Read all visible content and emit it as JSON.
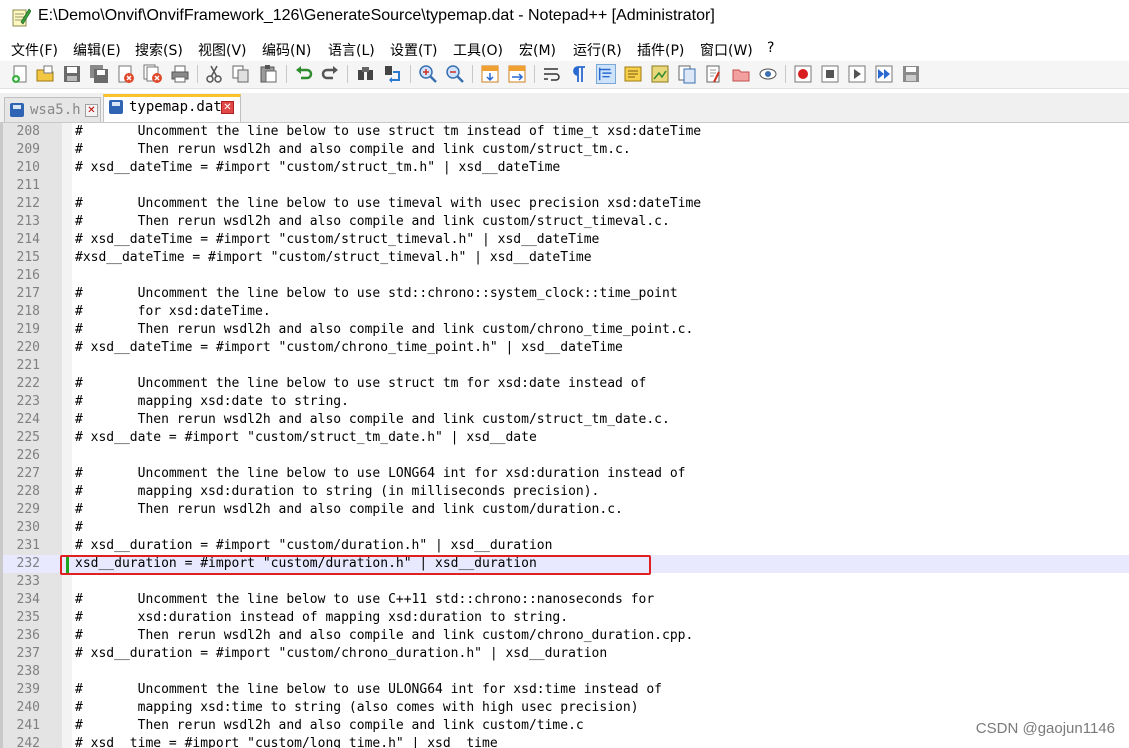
{
  "window": {
    "title": "E:\\Demo\\Onvif\\OnvifFramework_126\\GenerateSource\\typemap.dat - Notepad++ [Administrator]",
    "app_icon": "notepad-icon"
  },
  "menu": [
    "文件(F)",
    "编辑(E)",
    "搜索(S)",
    "视图(V)",
    "编码(N)",
    "语言(L)",
    "设置(T)",
    "工具(O)",
    "宏(M)",
    "运行(R)",
    "插件(P)",
    "窗口(W)",
    "?"
  ],
  "toolbar": [
    "new-file-icon",
    "open-file-icon",
    "save-icon",
    "save-all-icon",
    "close-icon",
    "close-all-icon",
    "print-icon",
    "cut-icon",
    "copy-icon",
    "paste-icon",
    "undo-icon",
    "redo-icon",
    "find-icon",
    "replace-icon",
    "zoom-in-icon",
    "zoom-out-icon",
    "sync-vertical-icon",
    "sync-horizontal-icon",
    "word-wrap-icon",
    "show-all-chars-icon",
    "indent-guide-icon",
    "udl-icon",
    "doc-map-icon",
    "function-list-icon",
    "folder-workspace-icon",
    "doc-list-icon",
    "monitor-icon",
    "record-macro-icon",
    "stop-macro-icon",
    "play-macro-icon",
    "run-macro-multiple-icon",
    "save-macro-icon"
  ],
  "tabs": [
    {
      "label": "wsa5.h",
      "active": false
    },
    {
      "label": "typemap.dat",
      "active": true
    }
  ],
  "editor": {
    "current_line": 232,
    "lines": [
      {
        "n": "208",
        "text": "#       Uncomment the line below to use struct tm instead of time_t xsd:dateTime"
      },
      {
        "n": "209",
        "text": "#       Then rerun wsdl2h and also compile and link custom/struct_tm.c."
      },
      {
        "n": "210",
        "text": "# xsd__dateTime = #import \"custom/struct_tm.h\" | xsd__dateTime"
      },
      {
        "n": "211",
        "text": ""
      },
      {
        "n": "212",
        "text": "#       Uncomment the line below to use timeval with usec precision xsd:dateTime"
      },
      {
        "n": "213",
        "text": "#       Then rerun wsdl2h and also compile and link custom/struct_timeval.c."
      },
      {
        "n": "214",
        "text": "# xsd__dateTime = #import \"custom/struct_timeval.h\" | xsd__dateTime"
      },
      {
        "n": "215",
        "text": "#xsd__dateTime = #import \"custom/struct_timeval.h\" | xsd__dateTime"
      },
      {
        "n": "216",
        "text": ""
      },
      {
        "n": "217",
        "text": "#       Uncomment the line below to use std::chrono::system_clock::time_point"
      },
      {
        "n": "218",
        "text": "#       for xsd:dateTime."
      },
      {
        "n": "219",
        "text": "#       Then rerun wsdl2h and also compile and link custom/chrono_time_point.c."
      },
      {
        "n": "220",
        "text": "# xsd__dateTime = #import \"custom/chrono_time_point.h\" | xsd__dateTime"
      },
      {
        "n": "221",
        "text": ""
      },
      {
        "n": "222",
        "text": "#       Uncomment the line below to use struct tm for xsd:date instead of"
      },
      {
        "n": "223",
        "text": "#       mapping xsd:date to string."
      },
      {
        "n": "224",
        "text": "#       Then rerun wsdl2h and also compile and link custom/struct_tm_date.c."
      },
      {
        "n": "225",
        "text": "# xsd__date = #import \"custom/struct_tm_date.h\" | xsd__date"
      },
      {
        "n": "226",
        "text": ""
      },
      {
        "n": "227",
        "text": "#       Uncomment the line below to use LONG64 int for xsd:duration instead of"
      },
      {
        "n": "228",
        "text": "#       mapping xsd:duration to string (in milliseconds precision)."
      },
      {
        "n": "229",
        "text": "#       Then rerun wsdl2h and also compile and link custom/duration.c."
      },
      {
        "n": "230",
        "text": "#"
      },
      {
        "n": "231",
        "text": "# xsd__duration = #import \"custom/duration.h\" | xsd__duration"
      },
      {
        "n": "232",
        "text": "xsd__duration = #import \"custom/duration.h\" | xsd__duration"
      },
      {
        "n": "233",
        "text": ""
      },
      {
        "n": "234",
        "text": "#       Uncomment the line below to use C++11 std::chrono::nanoseconds for"
      },
      {
        "n": "235",
        "text": "#       xsd:duration instead of mapping xsd:duration to string."
      },
      {
        "n": "236",
        "text": "#       Then rerun wsdl2h and also compile and link custom/chrono_duration.cpp."
      },
      {
        "n": "237",
        "text": "# xsd__duration = #import \"custom/chrono_duration.h\" | xsd__duration"
      },
      {
        "n": "238",
        "text": ""
      },
      {
        "n": "239",
        "text": "#       Uncomment the line below to use ULONG64 int for xsd:time instead of"
      },
      {
        "n": "240",
        "text": "#       mapping xsd:time to string (also comes with high usec precision)"
      },
      {
        "n": "241",
        "text": "#       Then rerun wsdl2h and also compile and link custom/time.c"
      },
      {
        "n": "242",
        "text": "# xsd__time = #import \"custom/long_time.h\" | xsd__time"
      }
    ]
  },
  "watermark": "CSDN @gaojun1146",
  "colors": {
    "highlight_border": "#e02020",
    "current_line_bg": "#e8e8ff",
    "active_tab_accent": "#fac22b"
  }
}
